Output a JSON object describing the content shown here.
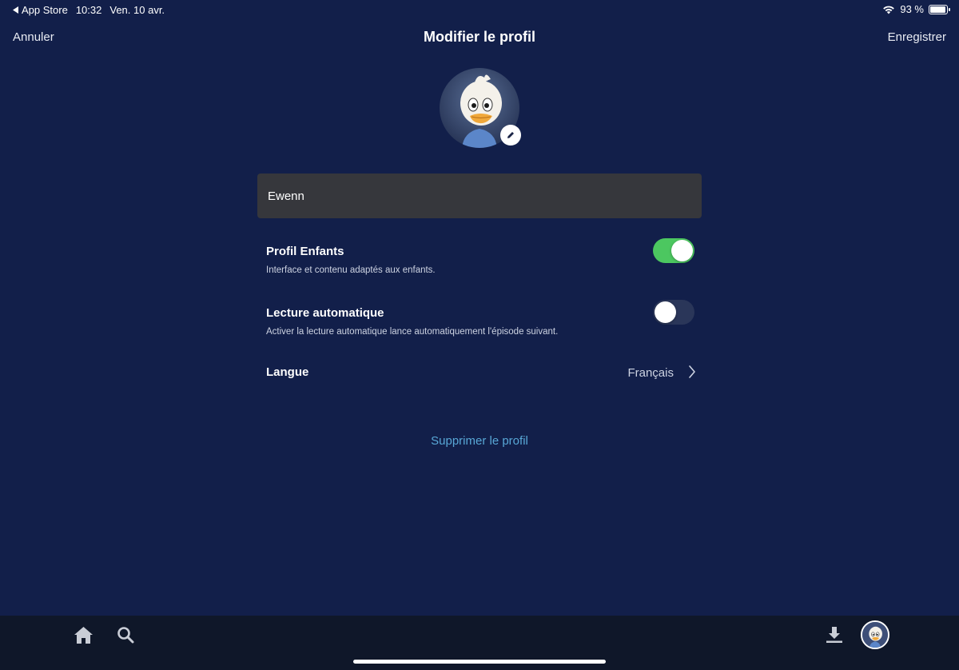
{
  "status_bar": {
    "back_app": "App Store",
    "time": "10:32",
    "date": "Ven. 10 avr.",
    "battery": "93 %",
    "battery_level": 0.93,
    "back_icon": "back-triangle-icon",
    "wifi_icon": "wifi-icon"
  },
  "nav": {
    "cancel_label": "Annuler",
    "title": "Modifier le profil",
    "save_label": "Enregistrer"
  },
  "profile": {
    "avatar_icon": "duck-avatar",
    "edit_icon": "pencil-icon",
    "name_value": "Ewenn"
  },
  "settings": {
    "kids": {
      "title": "Profil Enfants",
      "description": "Interface et contenu adaptés aux enfants.",
      "enabled": true
    },
    "autoplay": {
      "title": "Lecture automatique",
      "description": "Activer la lecture automatique lance automatiquement l'épisode suivant.",
      "enabled": false
    },
    "language": {
      "title": "Langue",
      "value": "Français",
      "icon": "chevron-right-icon"
    }
  },
  "delete_label": "Supprimer le profil",
  "tab_bar": {
    "items": [
      "home-icon",
      "search-icon",
      "download-icon",
      "profile-avatar"
    ]
  },
  "colors": {
    "background": "#121f4a",
    "toggle_on": "#4cc760",
    "toggle_off": "#2a3659",
    "link": "#58a7d6",
    "field": "#36373c",
    "tab_bar": "#0f1729"
  }
}
